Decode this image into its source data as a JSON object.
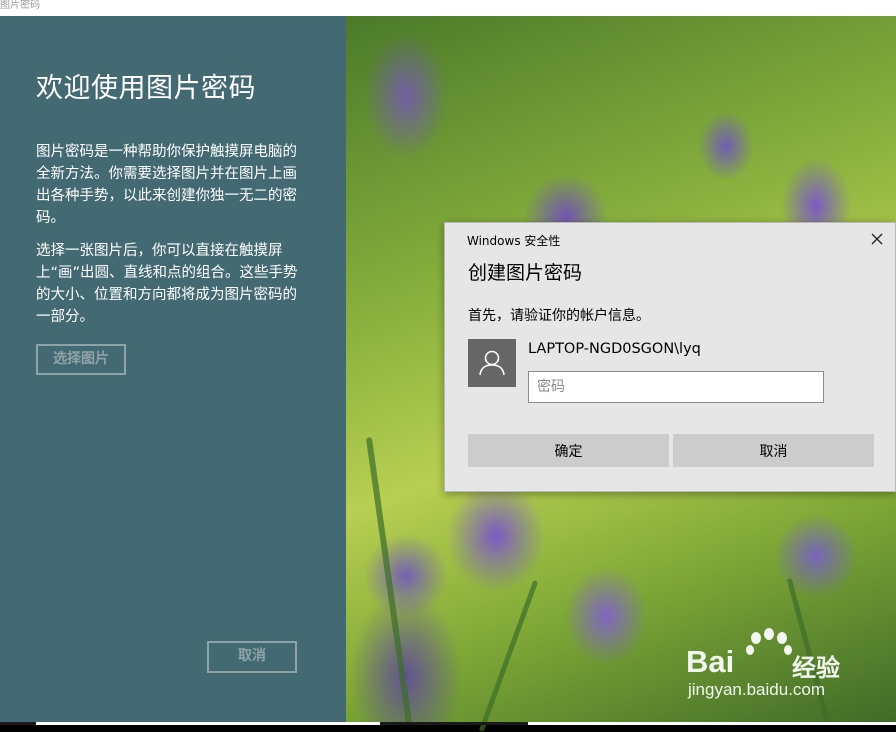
{
  "window": {
    "title": "图片密码"
  },
  "left_panel": {
    "heading": "欢迎使用图片密码",
    "paragraph_1": "图片密码是一种帮助你保护触摸屏电脑的全新方法。你需要选择图片并在图片上画出各种手势，以此来创建你独一无二的密码。",
    "paragraph_2": "选择一张图片后，你可以直接在触摸屏上“画”出圆、直线和点的组合。这些手势的大小、位置和方向都将成为图片密码的一部分。",
    "choose_button": "选择图片",
    "cancel_button": "取消"
  },
  "dialog": {
    "caption": "Windows 安全性",
    "title": "创建图片密码",
    "prompt": "首先，请验证你的帐户信息。",
    "username": "LAPTOP-NGD0SGON\\lyq",
    "password_placeholder": "密码",
    "password_value": "",
    "ok_button": "确定",
    "cancel_button": "取消",
    "close_icon": "close-icon",
    "avatar_icon": "user-icon"
  },
  "watermark": {
    "brand": "Bai",
    "brand_suffix": "经验",
    "url": "jingyan.baidu.com"
  },
  "colors": {
    "left_panel_bg": "#436a73",
    "dialog_bg": "#e6e6e6",
    "button_bg": "#cccccc",
    "avatar_bg": "#666666"
  }
}
